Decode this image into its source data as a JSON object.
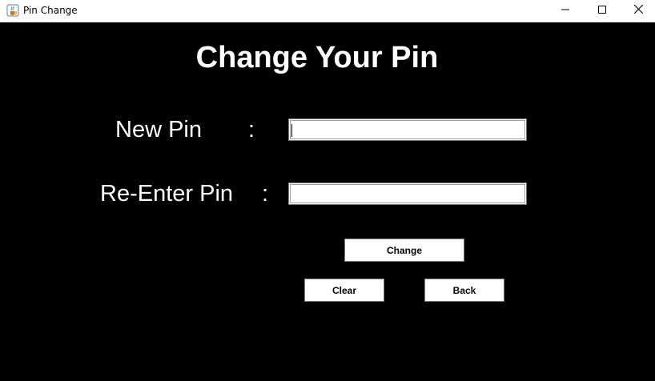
{
  "window": {
    "title": "Pin Change",
    "icon": "java-coffee-cup-icon",
    "controls": [
      "minimize-icon",
      "maximize-icon",
      "close-icon"
    ]
  },
  "form": {
    "heading": "Change Your Pin",
    "new_pin": {
      "label": "New Pin",
      "colon": ":",
      "value": ""
    },
    "reenter_pin": {
      "label": "Re-Enter Pin",
      "colon": ":",
      "value": ""
    }
  },
  "buttons": {
    "change": "Change",
    "clear": "Clear",
    "back": "Back"
  },
  "colors": {
    "background": "#000000",
    "text": "#ffffff",
    "field": "#ffffff",
    "button": "#ffffff"
  }
}
